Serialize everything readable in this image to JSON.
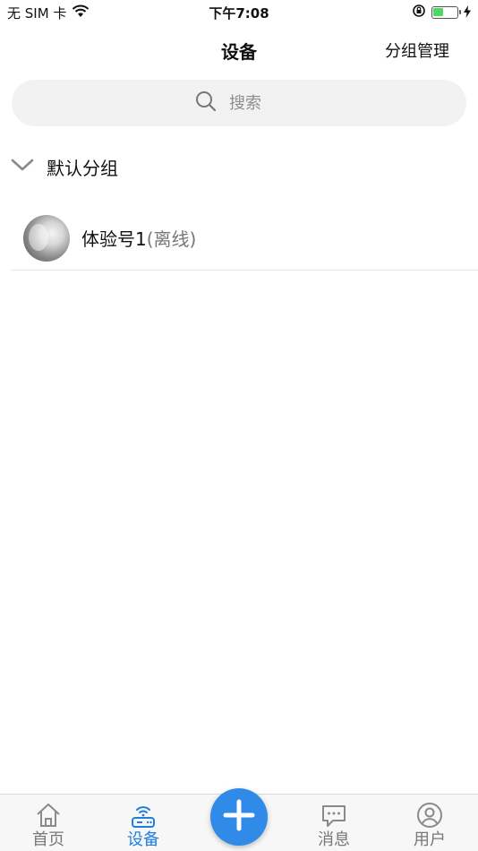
{
  "status_bar": {
    "carrier": "无 SIM 卡",
    "time": "下午7:08",
    "battery_level": 0.45,
    "battery_color": "#4cd964"
  },
  "nav": {
    "title": "设备",
    "action_label": "分组管理"
  },
  "search": {
    "placeholder": "搜索",
    "icon": "search-icon"
  },
  "group": {
    "title": "默认分组",
    "icon": "chevron-down-icon"
  },
  "devices": [
    {
      "name": "体验号1",
      "status": "(离线)"
    }
  ],
  "tabs": [
    {
      "label": "首页",
      "icon": "home-icon",
      "active": false
    },
    {
      "label": "设备",
      "icon": "router-icon",
      "active": true
    },
    {
      "label": "消息",
      "icon": "message-icon",
      "active": false
    },
    {
      "label": "用户",
      "icon": "user-icon",
      "active": false
    }
  ],
  "fab": {
    "icon": "plus-icon"
  },
  "colors": {
    "accent": "#1e7fe0",
    "fab": "#2f8ae8",
    "inactive": "#777777"
  }
}
